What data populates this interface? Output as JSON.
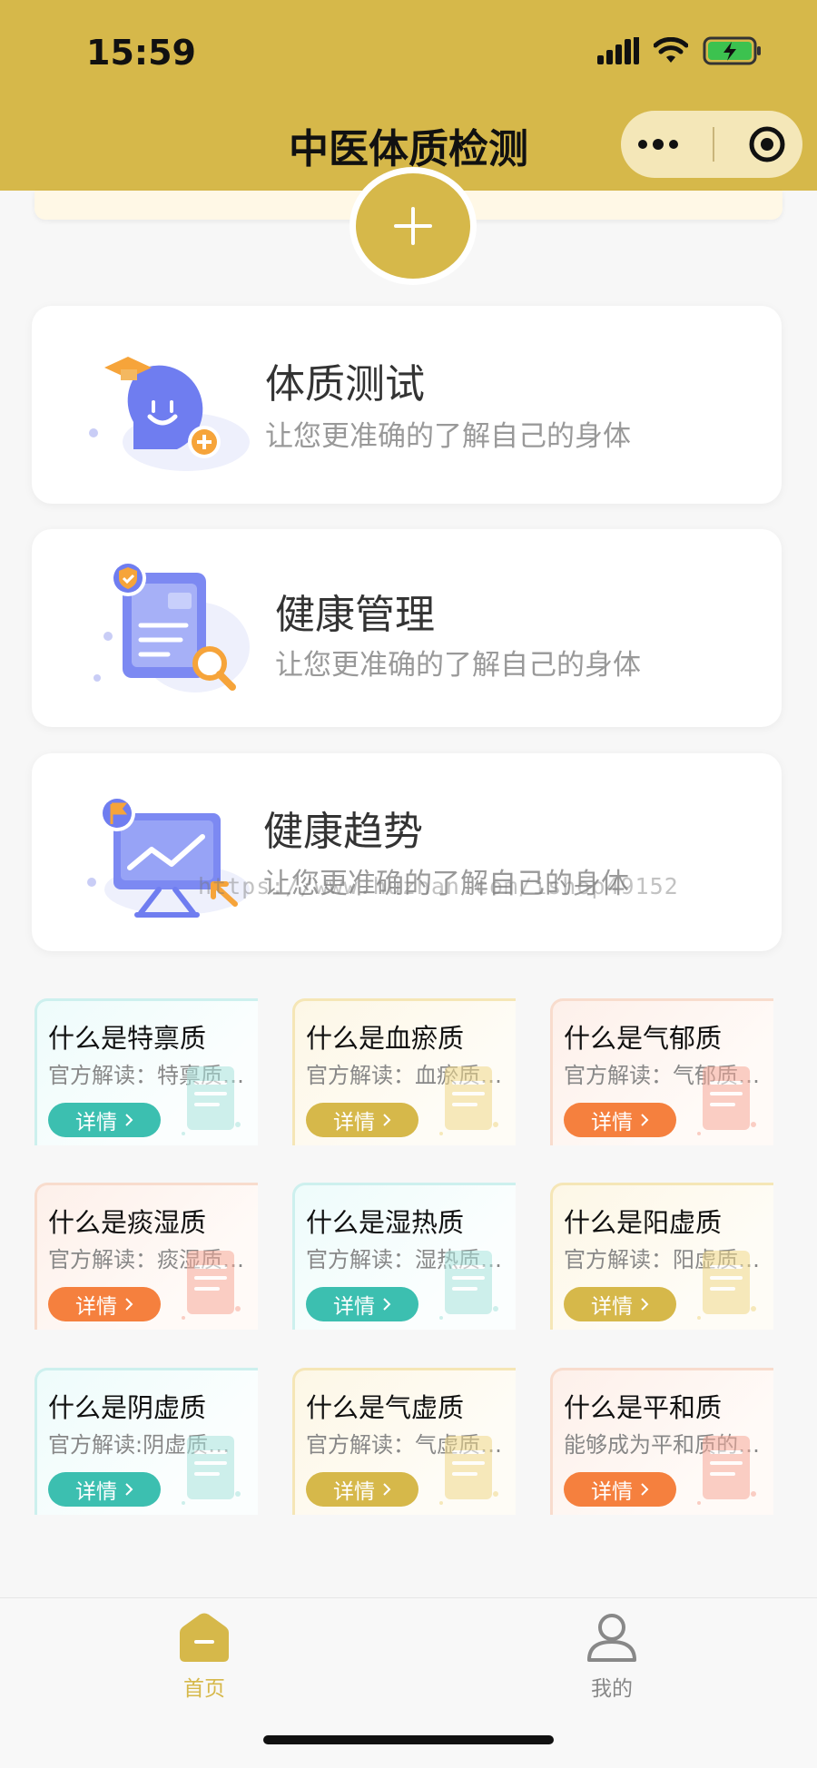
{
  "status": {
    "time": "15:59"
  },
  "header": {
    "title": "中医体质检测"
  },
  "cards": [
    {
      "title": "体质测试",
      "subtitle": "让您更准确的了解自己的身体"
    },
    {
      "title": "健康管理",
      "subtitle": "让您更准确的了解自己的身体"
    },
    {
      "title": "健康趋势",
      "subtitle": "让您更准确的了解自己的身体"
    }
  ],
  "watermark": "https://www.huzhan.com/ishop49152",
  "tiles": [
    {
      "title": "什么是特禀质",
      "subtitle": "官方解读：特禀质是一种",
      "button": "详情",
      "theme": "teal"
    },
    {
      "title": "什么是血瘀质",
      "subtitle": "官方解读：血瘀质是一种",
      "button": "详情",
      "theme": "gold"
    },
    {
      "title": "什么是气郁质",
      "subtitle": "官方解读：气郁质是一种",
      "button": "详情",
      "theme": "orange"
    },
    {
      "title": "什么是痰湿质",
      "subtitle": "官方解读：痰湿质是一种",
      "button": "详情",
      "theme": "orange"
    },
    {
      "title": "什么是湿热质",
      "subtitle": "官方解读：湿热质是一种",
      "button": "详情",
      "theme": "teal"
    },
    {
      "title": "什么是阳虚质",
      "subtitle": "官方解读：阳虚质是一种",
      "button": "详情",
      "theme": "gold"
    },
    {
      "title": "什么是阴虚质",
      "subtitle": "官方解读:阴虚质是一种",
      "button": "详情",
      "theme": "teal"
    },
    {
      "title": "什么是气虚质",
      "subtitle": "官方解读：气虚质是一种",
      "button": "详情",
      "theme": "gold"
    },
    {
      "title": "什么是平和质",
      "subtitle": "能够成为平和质的人群",
      "button": "详情",
      "theme": "orange"
    }
  ],
  "tabbar": {
    "home": {
      "label": "首页",
      "color": "#d6b84a"
    },
    "mine": {
      "label": "我的",
      "color": "#888888"
    }
  },
  "colors": {
    "brand": "#d6b84a",
    "teal": "#3cbfb0",
    "orange": "#f5803e"
  }
}
